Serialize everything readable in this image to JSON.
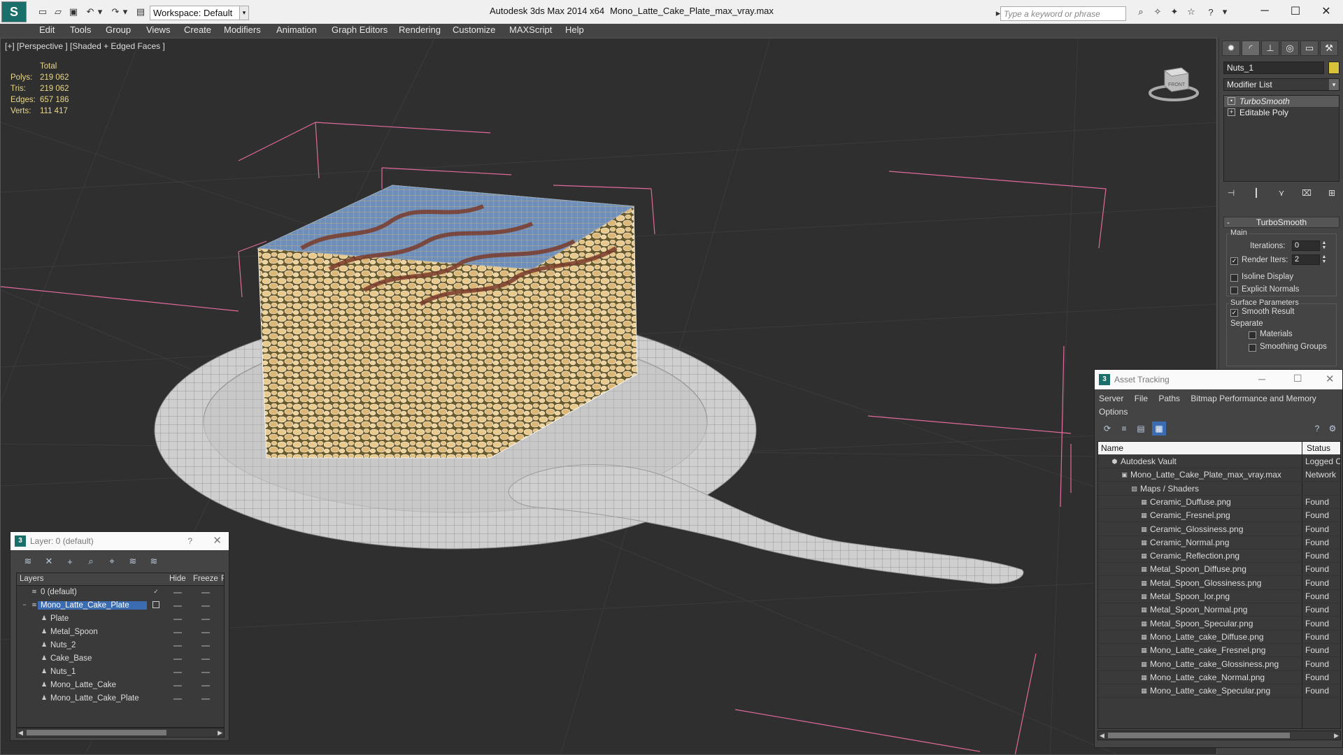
{
  "app": {
    "title": "Autodesk 3ds Max  2014 x64",
    "file": "Mono_Latte_Cake_Plate_max_vray.max",
    "workspace": "Workspace: Default",
    "search_placeholder": "Type a keyword or phrase",
    "logo_letter": "S"
  },
  "menu": [
    "Edit",
    "Tools",
    "Group",
    "Views",
    "Create",
    "Modifiers",
    "Animation",
    "Graph Editors",
    "Rendering",
    "Customize",
    "MAXScript",
    "Help"
  ],
  "viewport": {
    "label": "[+] [Perspective ] [Shaded + Edged Faces ]",
    "stats_header": "Total",
    "stats": [
      {
        "key": "Polys:",
        "value": "219 062"
      },
      {
        "key": "Tris:",
        "value": "219 062"
      },
      {
        "key": "Edges:",
        "value": "657 186"
      },
      {
        "key": "Verts:",
        "value": "111 417"
      }
    ],
    "viewcube_label": "FRONT"
  },
  "command_panel": {
    "object_name": "Nuts_1",
    "modifier_list": "Modifier List",
    "stack": [
      "TurboSmooth",
      "Editable Poly"
    ],
    "rollout": "TurboSmooth",
    "main_group": "Main",
    "iterations_label": "Iterations:",
    "iterations_value": "0",
    "render_iters_label": "Render Iters:",
    "render_iters_value": "2",
    "isoline": "Isoline Display",
    "explicit": "Explicit Normals",
    "surface_group": "Surface Parameters",
    "smooth_result": "Smooth Result",
    "separate": "Separate",
    "materials": "Materials",
    "smoothing_groups": "Smoothing Groups"
  },
  "layer_dialog": {
    "title": "Layer: 0 (default)",
    "help": "?",
    "col_layers": "Layers",
    "col_hide": "Hide",
    "col_freeze": "Freeze",
    "col_r": "R",
    "rows": [
      {
        "name": "0 (default)",
        "level": 0
      },
      {
        "name": "Mono_Latte_Cake_Plate",
        "level": 0
      },
      {
        "name": "Plate",
        "level": 1
      },
      {
        "name": "Metal_Spoon",
        "level": 1
      },
      {
        "name": "Nuts_2",
        "level": 1
      },
      {
        "name": "Cake_Base",
        "level": 1
      },
      {
        "name": "Nuts_1",
        "level": 1
      },
      {
        "name": "Mono_Latte_Cake",
        "level": 1
      },
      {
        "name": "Mono_Latte_Cake_Plate",
        "level": 1
      }
    ]
  },
  "asset_dialog": {
    "title": "Asset Tracking",
    "menu": [
      "Server",
      "File",
      "Paths",
      "Bitmap Performance and Memory",
      "Options"
    ],
    "col_name": "Name",
    "col_status": "Status",
    "rows": [
      {
        "name": "Autodesk Vault",
        "status": "Logged C",
        "level": 1
      },
      {
        "name": "Mono_Latte_Cake_Plate_max_vray.max",
        "status": "Network",
        "level": 2
      },
      {
        "name": "Maps / Shaders",
        "status": "",
        "level": 3
      },
      {
        "name": "Ceramic_Duffuse.png",
        "status": "Found",
        "level": 4
      },
      {
        "name": "Ceramic_Fresnel.png",
        "status": "Found",
        "level": 4
      },
      {
        "name": "Ceramic_Glossiness.png",
        "status": "Found",
        "level": 4
      },
      {
        "name": "Ceramic_Normal.png",
        "status": "Found",
        "level": 4
      },
      {
        "name": "Ceramic_Reflection.png",
        "status": "Found",
        "level": 4
      },
      {
        "name": "Metal_Spoon_Diffuse.png",
        "status": "Found",
        "level": 4
      },
      {
        "name": "Metal_Spoon_Glossiness.png",
        "status": "Found",
        "level": 4
      },
      {
        "name": "Metal_Spoon_Ior.png",
        "status": "Found",
        "level": 4
      },
      {
        "name": "Metal_Spoon_Normal.png",
        "status": "Found",
        "level": 4
      },
      {
        "name": "Metal_Spoon_Specular.png",
        "status": "Found",
        "level": 4
      },
      {
        "name": "Mono_Latte_cake_Diffuse.png",
        "status": "Found",
        "level": 4
      },
      {
        "name": "Mono_Latte_cake_Fresnel.png",
        "status": "Found",
        "level": 4
      },
      {
        "name": "Mono_Latte_cake_Glossiness.png",
        "status": "Found",
        "level": 4
      },
      {
        "name": "Mono_Latte_cake_Normal.png",
        "status": "Found",
        "level": 4
      },
      {
        "name": "Mono_Latte_cake_Specular.png",
        "status": "Found",
        "level": 4
      }
    ]
  }
}
